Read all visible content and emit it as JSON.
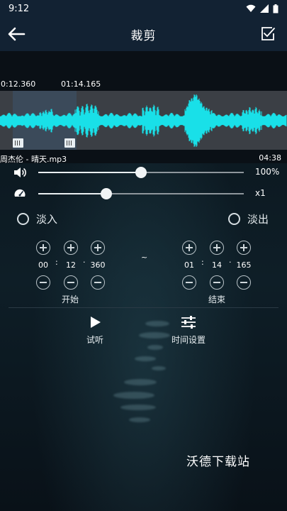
{
  "status_bar": {
    "time": "9:12"
  },
  "toolbar": {
    "title": "裁剪"
  },
  "waveform": {
    "start_time": "0:12.360",
    "end_time": "01:14.165",
    "selection_start_fraction": 0.045,
    "selection_end_fraction": 0.265
  },
  "file": {
    "name": "周杰伦 - 晴天.mp3",
    "duration": "04:38"
  },
  "volume": {
    "value": "100%",
    "level": 0.5
  },
  "speed": {
    "value": "x1",
    "level": 0.33
  },
  "fade": {
    "fade_in": "淡入",
    "fade_out": "淡出"
  },
  "start": {
    "label": "开始",
    "minutes": "00",
    "seconds": "12",
    "millis": "360"
  },
  "end": {
    "label": "结束",
    "minutes": "01",
    "seconds": "14",
    "millis": "165"
  },
  "separator": "~",
  "actions": {
    "preview": "试听",
    "time_settings": "时间设置"
  },
  "watermark": "沃德下载站",
  "colors": {
    "wave": "#19e0e8",
    "toolbar": "#122233"
  }
}
